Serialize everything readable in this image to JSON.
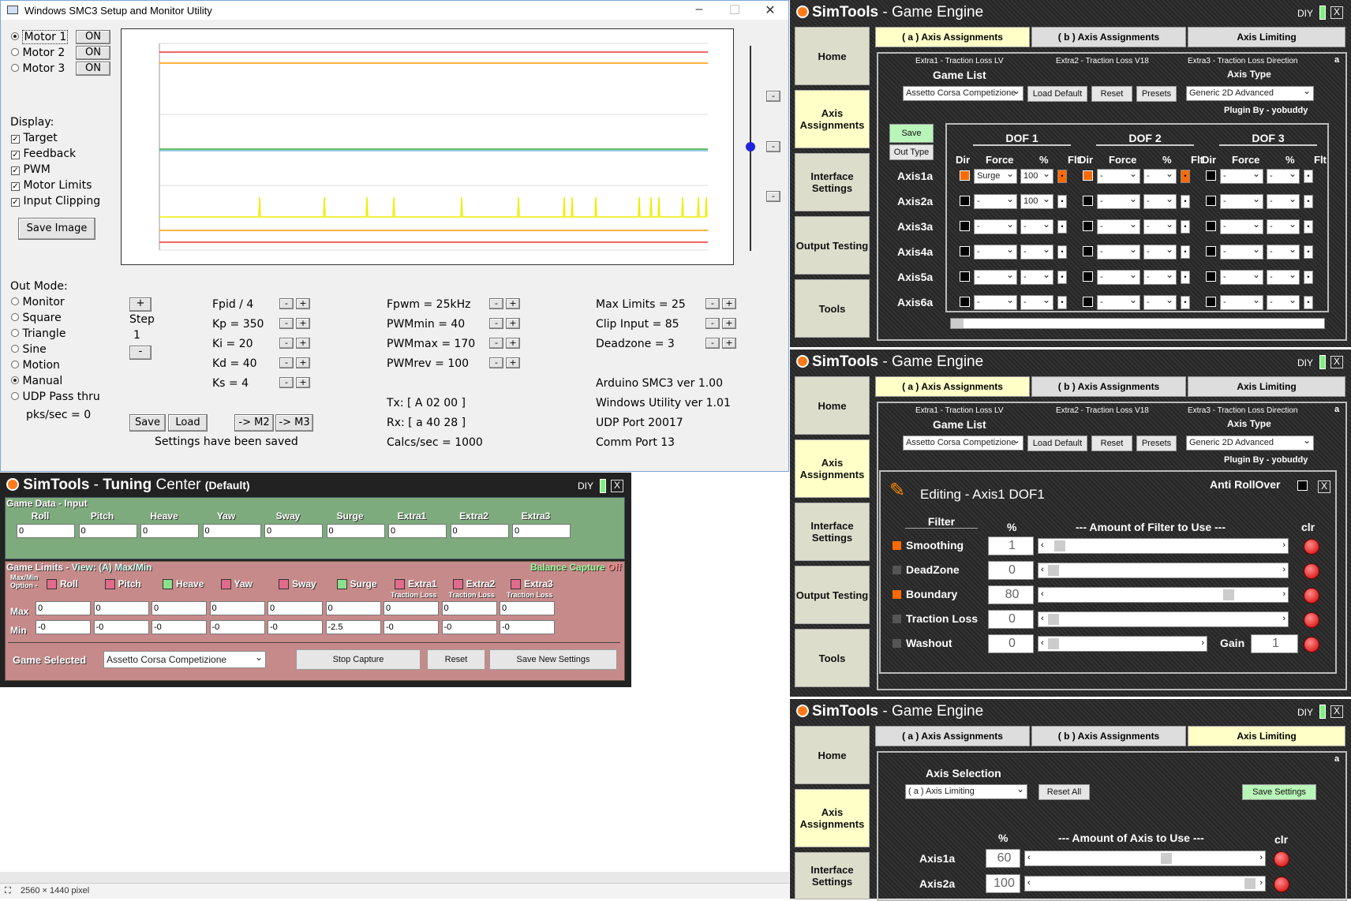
{
  "smc3": {
    "title": "Windows SMC3 Setup and Monitor Utility",
    "motors": [
      {
        "label": "Motor 1",
        "state": "ON",
        "selected": true
      },
      {
        "label": "Motor 2",
        "state": "ON",
        "selected": false
      },
      {
        "label": "Motor 3",
        "state": "ON",
        "selected": false
      }
    ],
    "display_label": "Display:",
    "display_items": [
      "Target",
      "Feedback",
      "PWM",
      "Motor Limits",
      "Input Clipping"
    ],
    "save_image": "Save Image",
    "out_mode_label": "Out Mode:",
    "out_modes": [
      {
        "label": "Monitor",
        "selected": false
      },
      {
        "label": "Square",
        "selected": false
      },
      {
        "label": "Triangle",
        "selected": false
      },
      {
        "label": "Sine",
        "selected": false
      },
      {
        "label": "Motion",
        "selected": false
      },
      {
        "label": "Manual",
        "selected": true
      },
      {
        "label": "UDP Pass thru",
        "selected": false
      }
    ],
    "pks": "pks/sec = 0",
    "step_plus": "+",
    "step_label": "Step",
    "step_value": "1",
    "step_minus": "-",
    "pid": [
      "Fpid / 4",
      "Kp = 350",
      "Ki = 20",
      "Kd = 40",
      "Ks = 4"
    ],
    "pwm": [
      "Fpwm = 25kHz",
      "PWMmin = 40",
      "PWMmax = 170",
      "PWMrev = 100"
    ],
    "limits": [
      "Max Limits = 25",
      "Clip Input = 85",
      "Deadzone = 3"
    ],
    "tx": "Tx: [ A 02 00 ]",
    "rx": "Rx: [ a 40 28 ]",
    "calcs": "Calcs/sec = 1000",
    "versions": [
      "Arduino SMC3 ver 1.00",
      "Windows Utility ver 1.01",
      "UDP Port 20017",
      "Comm Port 13"
    ],
    "save": "Save",
    "load": "Load",
    "to_m2": "-> M2",
    "to_m3": "-> M3",
    "settings_status": "Settings have been saved",
    "minus": "-",
    "plus": "+"
  },
  "statusbar": {
    "text": "2560 × 1440 pixel"
  },
  "sim_common": {
    "brand": "SimTools",
    "sep": " - ",
    "engine": "Game Engine",
    "diy": "DIY",
    "close": "X",
    "sidebar": [
      "Home",
      "Axis Assignments",
      "Interface Settings",
      "Output Testing",
      "Tools"
    ],
    "tabs": [
      "( a ) Axis Assignments",
      "( b ) Axis Assignments",
      "Axis Limiting"
    ],
    "corner": "a"
  },
  "engine1": {
    "extras": [
      "Extra1 - Traction Loss LV",
      "Extra2 - Traction Loss V18",
      "Extra3 - Traction Loss Direction"
    ],
    "game_list_label": "Game List",
    "game": "Assetto Corsa Competizione",
    "load_default": "Load Default",
    "reset": "Reset",
    "presets": "Presets",
    "axis_type_label": "Axis Type",
    "axis_type": "Generic 2D Advanced",
    "plugin": "Plugin By - yobuddy",
    "save": "Save",
    "out_type": "Out Type",
    "dofs": [
      "DOF 1",
      "DOF 2",
      "DOF 3"
    ],
    "col_heads": [
      "Dir",
      "Force",
      "%",
      "Flt"
    ],
    "axes": [
      {
        "name": "Axis1a",
        "force": "Surge",
        "pct": "100"
      },
      {
        "name": "Axis2a",
        "force": "-",
        "pct": "100"
      },
      {
        "name": "Axis3a",
        "force": "-",
        "pct": "-"
      },
      {
        "name": "Axis4a",
        "force": "-",
        "pct": "-"
      },
      {
        "name": "Axis5a",
        "force": "-",
        "pct": "-"
      },
      {
        "name": "Axis6a",
        "force": "-",
        "pct": "-"
      }
    ],
    "dash": "-"
  },
  "engine2": {
    "editing": "Editing - Axis1 DOF1",
    "anti_rollover": "Anti RollOver",
    "filter_label": "Filter",
    "pct_label": "%",
    "amount_label": "---   Amount of Filter to Use   ---",
    "clr_label": "clr",
    "filters": [
      {
        "name": "Smoothing",
        "value": "1",
        "active": true,
        "fill": 0.03
      },
      {
        "name": "DeadZone",
        "value": "0",
        "active": false,
        "fill": 0.0
      },
      {
        "name": "Boundary",
        "value": "80",
        "active": true,
        "fill": 0.8
      },
      {
        "name": "Traction Loss",
        "value": "0",
        "active": false,
        "fill": 0.0
      },
      {
        "name": "Washout",
        "value": "0",
        "active": false,
        "fill": 0.0
      }
    ],
    "gain_label": "Gain",
    "gain_value": "1"
  },
  "engine3": {
    "axis_selection_label": "Axis Selection",
    "axis_selection": "( a ) Axis Limiting",
    "reset_all": "Reset All",
    "save_settings": "Save Settings",
    "pct_label": "%",
    "amount_label": "---   Amount of Axis to Use   ---",
    "clr_label": "clr",
    "axes": [
      {
        "name": "Axis1a",
        "value": "60",
        "fill": 0.6
      },
      {
        "name": "Axis2a",
        "value": "100",
        "fill": 1.0
      }
    ]
  },
  "tuning": {
    "brand": "SimTools",
    "sep": " - ",
    "name": "Tuning",
    "center": " Center",
    "profile": "(Default)",
    "diy": "DIY",
    "close": "X",
    "game_data_label": "Game Data - Input",
    "inputs": [
      "Roll",
      "Pitch",
      "Heave",
      "Yaw",
      "Sway",
      "Surge",
      "Extra1",
      "Extra2",
      "Extra3"
    ],
    "input_values": [
      "0",
      "0",
      "0",
      "0",
      "0",
      "0",
      "0",
      "0",
      "0"
    ],
    "game_limits_label": "Game Limits - ",
    "view_label": "View: (A) Max/Min",
    "balance": "Balance Capture",
    "balance_state": "Off",
    "option_label": "Max/Min Option -",
    "traction_loss": "Traction Loss",
    "max_label": "Max",
    "min_label": "Min",
    "max_values": [
      "0",
      "0",
      "0",
      "0",
      "0",
      "0",
      "0",
      "0",
      "0"
    ],
    "min_values": [
      "-0",
      "-0",
      "-0",
      "-0",
      "-0",
      "-2.5",
      "-0",
      "-0",
      "-0"
    ],
    "game_selected_label": "Game Selected",
    "game_selected": "Assetto Corsa Competizione",
    "stop_capture": "Stop Capture",
    "reset": "Reset",
    "save_new": "Save New Settings",
    "colors": {
      "pink": "#e06b8a",
      "green": "#8be08b"
    }
  }
}
